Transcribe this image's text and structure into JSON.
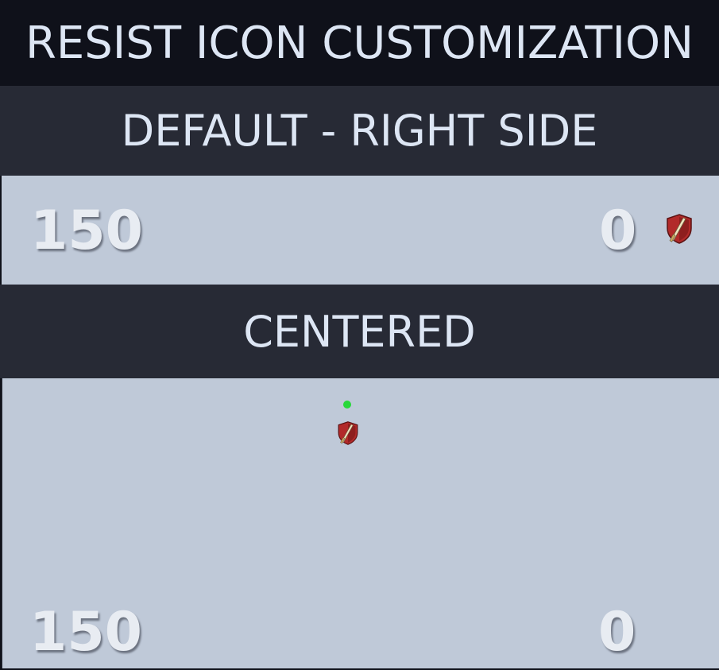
{
  "title": "RESIST ICON CUSTOMIZATION",
  "sections": [
    {
      "header": "DEFAULT - RIGHT SIDE",
      "left_value": "150",
      "right_value": "0",
      "icon": "shield-sword-icon"
    },
    {
      "header": "CENTERED",
      "left_value": "150",
      "right_value": "0",
      "icon": "shield-sword-icon"
    }
  ],
  "colors": {
    "title_bg": "#0f111a",
    "header_bg": "#272a35",
    "panel_bg": "#bfc9d8",
    "text": "#dde6f4",
    "shield_red": "#b22a2a",
    "marker_green": "#27d83a"
  }
}
